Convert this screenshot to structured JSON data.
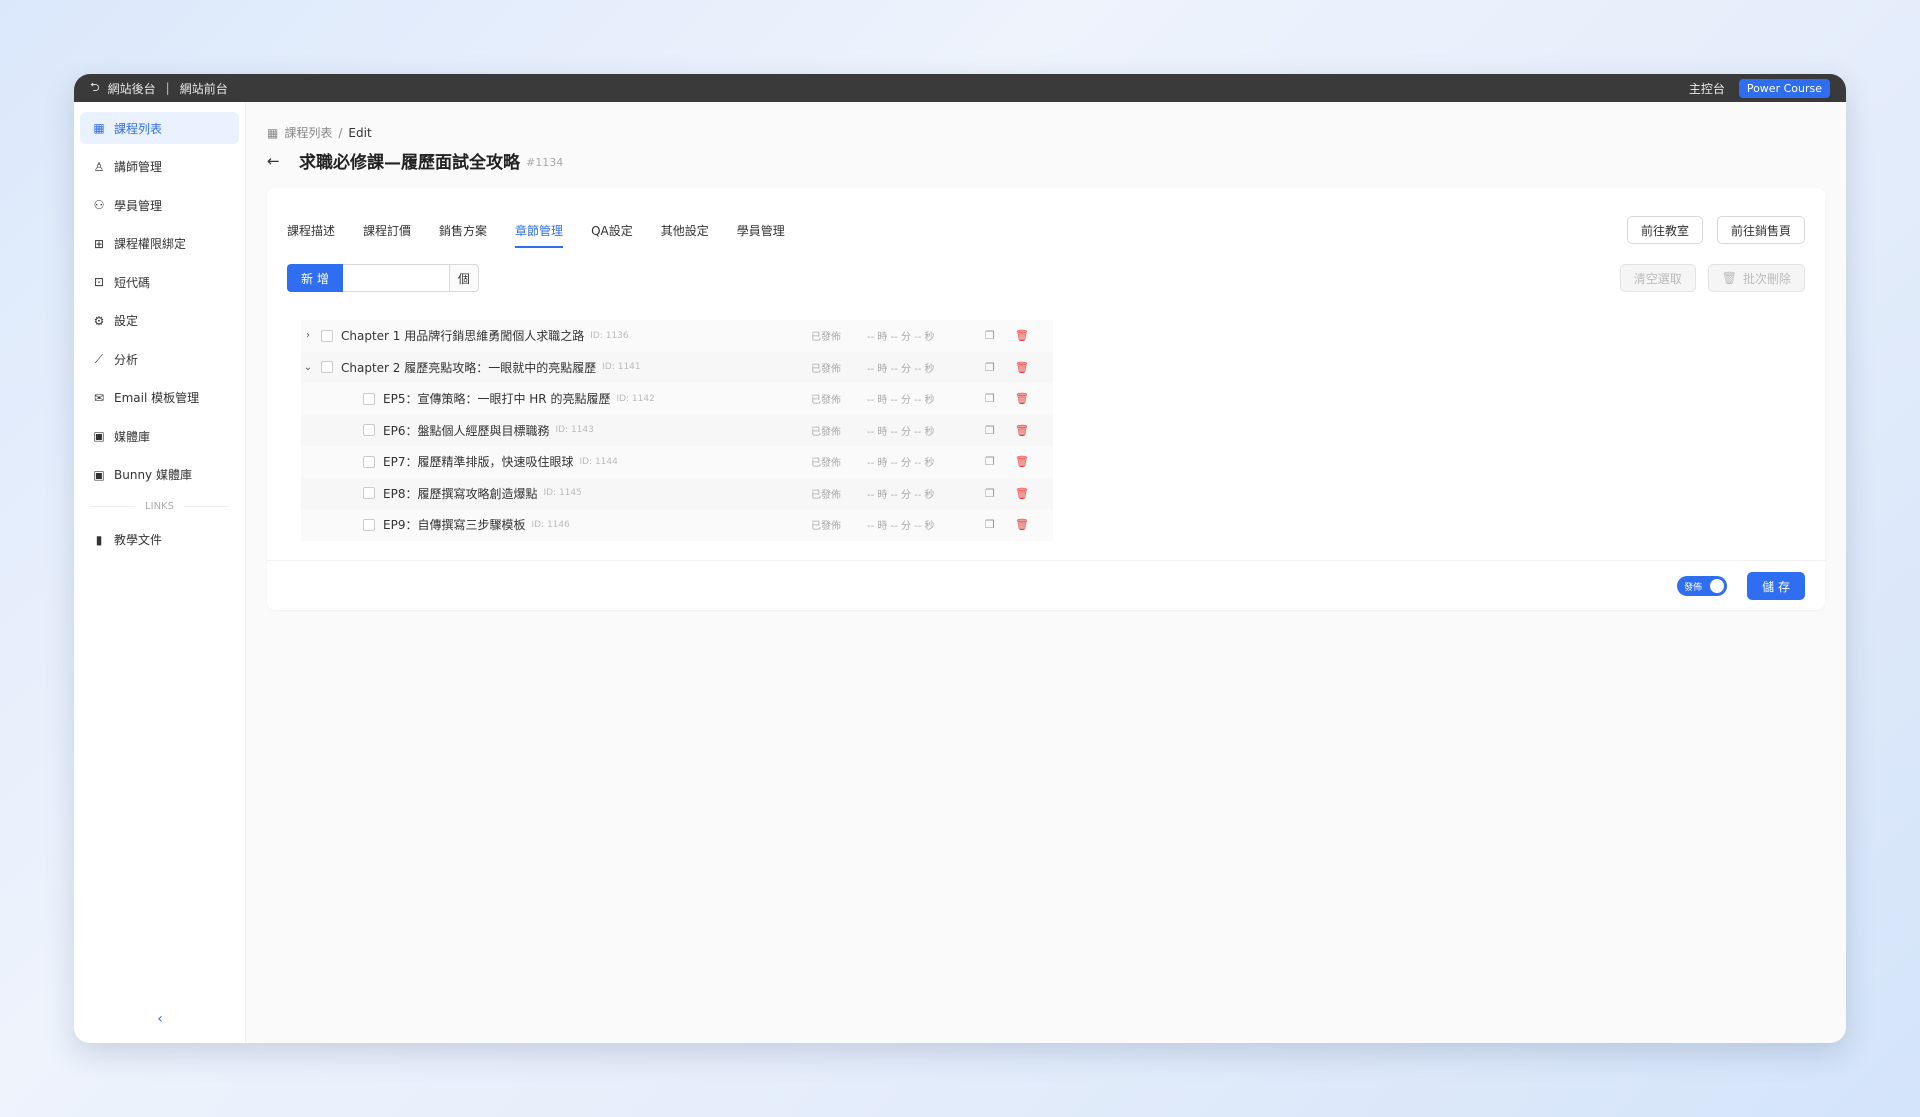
{
  "topbar": {
    "backend": "網站後台",
    "frontend": "網站前台",
    "dashboard": "主控台",
    "brand": "Power Course"
  },
  "sidebar": {
    "items": [
      {
        "label": "課程列表",
        "icon": "table-icon",
        "active": true
      },
      {
        "label": "講師管理",
        "icon": "user-icon"
      },
      {
        "label": "學員管理",
        "icon": "users-icon"
      },
      {
        "label": "課程權限綁定",
        "icon": "grid-icon"
      },
      {
        "label": "短代碼",
        "icon": "code-icon"
      },
      {
        "label": "設定",
        "icon": "gear-icon"
      },
      {
        "label": "分析",
        "icon": "chart-icon"
      },
      {
        "label": "Email 模板管理",
        "icon": "mail-icon"
      },
      {
        "label": "媒體庫",
        "icon": "media-icon"
      },
      {
        "label": "Bunny 媒體庫",
        "icon": "media-icon"
      }
    ],
    "links_label": "LINKS",
    "links": [
      {
        "label": "教學文件",
        "icon": "book-icon"
      }
    ]
  },
  "breadcrumb": {
    "parent": "課程列表",
    "current": "Edit"
  },
  "page": {
    "title": "求職必修課—履歷面試全攻略",
    "id": "#1134"
  },
  "tabs": [
    "課程描述",
    "課程訂價",
    "銷售方案",
    "章節管理",
    "QA設定",
    "其他設定",
    "學員管理"
  ],
  "tab_actions": {
    "classroom": "前往教室",
    "sales_page": "前往銷售頁"
  },
  "add": {
    "button": "新 增",
    "unit": "個"
  },
  "bulk": {
    "clear": "清空選取",
    "delete": "批次刪除"
  },
  "chapters": [
    {
      "name": "Chapter 1 用品牌行銷思維勇闖個人求職之路",
      "id": "ID: 1136",
      "status": "已發佈",
      "duration": "-- 時 -- 分 -- 秒",
      "level": 0,
      "expand": "›"
    },
    {
      "name": "Chapter 2 履歷亮點攻略：一眼就中的亮點履歷",
      "id": "ID: 1141",
      "status": "已發佈",
      "duration": "-- 時 -- 分 -- 秒",
      "level": 0,
      "expand": "⌄"
    },
    {
      "name": "EP5：宣傳策略：一眼打中 HR 的亮點履歷",
      "id": "ID: 1142",
      "status": "已發佈",
      "duration": "-- 時 -- 分 -- 秒",
      "level": 1
    },
    {
      "name": "EP6：盤點個人經歷與目標職務",
      "id": "ID: 1143",
      "status": "已發佈",
      "duration": "-- 時 -- 分 -- 秒",
      "level": 1
    },
    {
      "name": "EP7：履歷精準排版，快速吸住眼球",
      "id": "ID: 1144",
      "status": "已發佈",
      "duration": "-- 時 -- 分 -- 秒",
      "level": 1
    },
    {
      "name": "EP8：履歷撰寫攻略創造爆點",
      "id": "ID: 1145",
      "status": "已發佈",
      "duration": "-- 時 -- 分 -- 秒",
      "level": 1
    },
    {
      "name": "EP9：自傳撰寫三步驟模板",
      "id": "ID: 1146",
      "status": "已發佈",
      "duration": "-- 時 -- 分 -- 秒",
      "level": 1
    }
  ],
  "footer": {
    "publish_label": "發佈",
    "save": "儲 存"
  },
  "colors": {
    "accent": "#2f6ef0",
    "danger": "#e53935"
  }
}
